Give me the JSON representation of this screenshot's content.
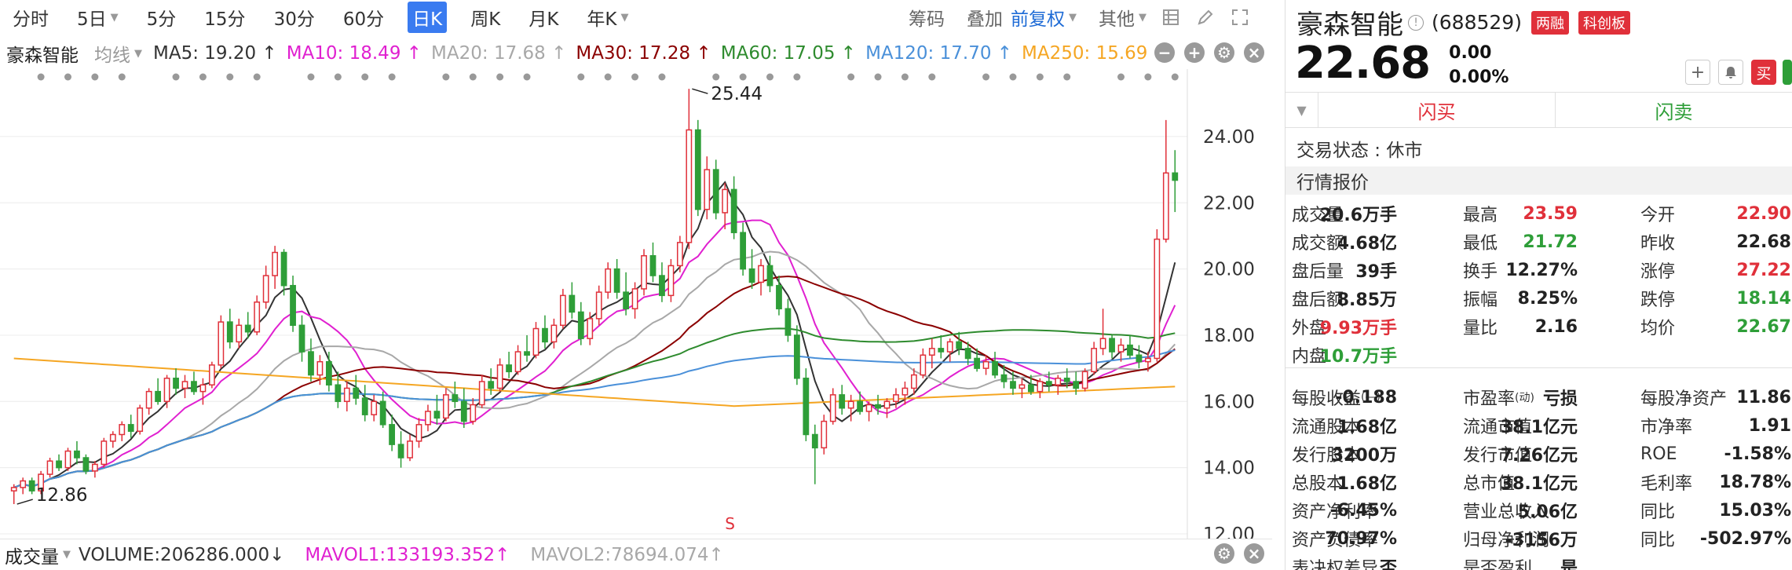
{
  "periods": [
    "分时",
    "5日",
    "5分",
    "15分",
    "30分",
    "60分",
    "日K",
    "周K",
    "月K",
    "年K"
  ],
  "active_period": "日K",
  "toolbar": {
    "chips": "筹码",
    "overlay": "叠加",
    "adjust": "前复权",
    "other": "其他"
  },
  "ma_bar": {
    "stock_name": "豪森智能",
    "mode": "均线",
    "items": [
      {
        "label": "MA5: 19.20 ↑",
        "color": "#333333"
      },
      {
        "label": "MA10: 18.49 ↑",
        "color": "#e020d0"
      },
      {
        "label": "MA20: 17.68 ↑",
        "color": "#a8a8a8"
      },
      {
        "label": "MA30: 17.28 ↑",
        "color": "#8b0000"
      },
      {
        "label": "MA60: 17.05 ↑",
        "color": "#2e8b2e"
      },
      {
        "label": "MA120: 17.70 ↑",
        "color": "#4a90d9"
      },
      {
        "label": "MA250: 15.69 ↑",
        "color": "#f5a623"
      }
    ]
  },
  "chart_annotations": {
    "high_label": "25.44",
    "low_label": "12.86",
    "signal": "S"
  },
  "volume_bar": {
    "label": "成交量",
    "items": [
      {
        "label": "VOLUME:206286.000↓",
        "color": "#333333"
      },
      {
        "label": "MAVOL1:133193.352↑",
        "color": "#e020d0"
      },
      {
        "label": "MAVOL2:78694.074↑",
        "color": "#a8a8a8"
      }
    ]
  },
  "chart_data": {
    "type": "candlestick",
    "y_ticks": [
      "24.00",
      "22.00",
      "20.00",
      "18.00",
      "16.00",
      "14.00",
      "12.00"
    ],
    "ylim": [
      12.0,
      25.8
    ],
    "grid": true,
    "high": 25.44,
    "low": 12.86,
    "candles": [
      [
        13.3,
        13.5,
        12.9,
        13.4
      ],
      [
        13.4,
        13.7,
        13.2,
        13.6
      ],
      [
        13.6,
        13.7,
        13.2,
        13.3
      ],
      [
        13.3,
        13.9,
        13.2,
        13.8
      ],
      [
        13.8,
        14.3,
        13.7,
        14.2
      ],
      [
        14.2,
        14.4,
        13.9,
        14.0
      ],
      [
        14.0,
        14.6,
        13.9,
        14.5
      ],
      [
        14.5,
        14.8,
        14.1,
        14.3
      ],
      [
        14.3,
        14.4,
        13.8,
        13.9
      ],
      [
        13.9,
        14.2,
        13.7,
        14.1
      ],
      [
        14.1,
        14.9,
        14.0,
        14.8
      ],
      [
        14.8,
        15.1,
        14.6,
        15.0
      ],
      [
        15.0,
        15.4,
        14.8,
        15.3
      ],
      [
        15.3,
        15.6,
        14.9,
        15.1
      ],
      [
        15.1,
        15.9,
        15.0,
        15.8
      ],
      [
        15.8,
        16.4,
        15.6,
        16.3
      ],
      [
        16.3,
        16.7,
        15.9,
        16.0
      ],
      [
        16.0,
        16.8,
        15.8,
        16.7
      ],
      [
        16.7,
        17.0,
        16.2,
        16.4
      ],
      [
        16.4,
        16.8,
        16.1,
        16.6
      ],
      [
        16.6,
        16.9,
        16.2,
        16.3
      ],
      [
        16.3,
        16.7,
        15.9,
        16.5
      ],
      [
        16.5,
        17.2,
        16.4,
        17.1
      ],
      [
        17.1,
        18.6,
        17.0,
        18.4
      ],
      [
        18.4,
        18.8,
        17.6,
        17.8
      ],
      [
        17.8,
        18.5,
        17.6,
        18.3
      ],
      [
        18.3,
        18.7,
        17.9,
        18.1
      ],
      [
        18.1,
        19.2,
        18.0,
        19.0
      ],
      [
        19.0,
        20.1,
        18.8,
        19.8
      ],
      [
        19.8,
        20.7,
        19.4,
        20.5
      ],
      [
        20.5,
        20.6,
        19.2,
        19.5
      ],
      [
        19.5,
        19.8,
        18.1,
        18.3
      ],
      [
        18.3,
        18.6,
        17.2,
        17.5
      ],
      [
        17.5,
        17.9,
        16.6,
        16.8
      ],
      [
        16.8,
        17.4,
        16.5,
        17.2
      ],
      [
        17.2,
        17.5,
        16.3,
        16.5
      ],
      [
        16.5,
        16.9,
        15.8,
        16.0
      ],
      [
        16.0,
        16.6,
        15.7,
        16.4
      ],
      [
        16.4,
        16.8,
        15.9,
        16.1
      ],
      [
        16.1,
        16.5,
        15.4,
        15.6
      ],
      [
        15.6,
        16.2,
        15.4,
        16.0
      ],
      [
        16.0,
        16.3,
        15.2,
        15.3
      ],
      [
        15.3,
        15.6,
        14.5,
        14.7
      ],
      [
        14.7,
        15.1,
        14.0,
        14.3
      ],
      [
        14.3,
        15.0,
        14.2,
        14.8
      ],
      [
        14.8,
        15.5,
        14.6,
        15.3
      ],
      [
        15.3,
        15.9,
        15.1,
        15.7
      ],
      [
        15.7,
        16.2,
        15.3,
        15.5
      ],
      [
        15.5,
        16.4,
        15.4,
        16.2
      ],
      [
        16.2,
        16.6,
        15.8,
        16.0
      ],
      [
        16.0,
        16.4,
        15.2,
        15.4
      ],
      [
        15.4,
        16.1,
        15.3,
        15.9
      ],
      [
        15.9,
        16.8,
        15.8,
        16.6
      ],
      [
        16.6,
        17.0,
        16.2,
        16.4
      ],
      [
        16.4,
        17.3,
        16.3,
        17.1
      ],
      [
        17.1,
        17.5,
        16.7,
        16.9
      ],
      [
        16.9,
        17.7,
        16.8,
        17.5
      ],
      [
        17.5,
        18.0,
        17.2,
        17.4
      ],
      [
        17.4,
        18.4,
        17.3,
        18.2
      ],
      [
        18.2,
        18.6,
        17.6,
        17.8
      ],
      [
        17.8,
        18.5,
        17.6,
        18.3
      ],
      [
        18.3,
        19.4,
        18.2,
        19.2
      ],
      [
        19.2,
        19.6,
        18.5,
        18.7
      ],
      [
        18.7,
        19.0,
        17.7,
        17.9
      ],
      [
        17.9,
        18.7,
        17.7,
        18.5
      ],
      [
        18.5,
        19.5,
        18.3,
        19.3
      ],
      [
        19.3,
        20.2,
        19.1,
        20.0
      ],
      [
        20.0,
        20.3,
        19.1,
        19.3
      ],
      [
        19.3,
        19.9,
        18.6,
        18.8
      ],
      [
        18.8,
        19.6,
        18.5,
        19.4
      ],
      [
        19.4,
        20.6,
        19.2,
        20.4
      ],
      [
        20.4,
        20.8,
        19.6,
        19.8
      ],
      [
        19.8,
        20.2,
        19.0,
        19.2
      ],
      [
        19.2,
        20.3,
        19.0,
        20.1
      ],
      [
        20.1,
        21.0,
        19.9,
        20.8
      ],
      [
        20.8,
        25.44,
        20.6,
        24.2
      ],
      [
        24.2,
        24.5,
        21.6,
        21.8
      ],
      [
        21.8,
        23.4,
        21.5,
        23.0
      ],
      [
        23.0,
        23.3,
        21.5,
        21.7
      ],
      [
        21.7,
        22.6,
        21.2,
        22.4
      ],
      [
        22.4,
        22.8,
        20.9,
        21.1
      ],
      [
        21.1,
        21.4,
        19.8,
        20.0
      ],
      [
        20.0,
        20.6,
        19.4,
        19.6
      ],
      [
        19.6,
        20.3,
        19.2,
        20.1
      ],
      [
        20.1,
        20.4,
        19.3,
        19.5
      ],
      [
        19.5,
        19.8,
        18.6,
        18.8
      ],
      [
        18.8,
        19.1,
        17.8,
        18.0
      ],
      [
        18.0,
        18.3,
        16.5,
        16.7
      ],
      [
        16.7,
        17.0,
        14.8,
        15.0
      ],
      [
        15.0,
        15.3,
        13.5,
        14.6
      ],
      [
        14.6,
        15.6,
        14.4,
        15.4
      ],
      [
        15.4,
        16.4,
        15.3,
        16.2
      ],
      [
        16.2,
        16.5,
        15.6,
        15.8
      ],
      [
        15.8,
        16.2,
        15.4,
        16.0
      ],
      [
        16.0,
        16.3,
        15.6,
        15.7
      ],
      [
        15.7,
        16.0,
        15.4,
        15.9
      ],
      [
        15.9,
        16.2,
        15.6,
        15.8
      ],
      [
        15.8,
        16.1,
        15.5,
        16.0
      ],
      [
        16.0,
        16.4,
        15.8,
        16.2
      ],
      [
        16.2,
        16.6,
        15.9,
        16.4
      ],
      [
        16.4,
        17.0,
        16.2,
        16.8
      ],
      [
        16.8,
        17.6,
        16.7,
        17.4
      ],
      [
        17.4,
        17.9,
        17.0,
        17.6
      ],
      [
        17.6,
        18.0,
        17.3,
        17.5
      ],
      [
        17.5,
        17.9,
        17.2,
        17.8
      ],
      [
        17.8,
        18.1,
        17.4,
        17.6
      ],
      [
        17.6,
        17.8,
        17.1,
        17.3
      ],
      [
        17.3,
        17.6,
        16.9,
        17.0
      ],
      [
        17.0,
        17.4,
        16.8,
        17.2
      ],
      [
        17.2,
        17.5,
        16.7,
        16.8
      ],
      [
        16.8,
        17.1,
        16.4,
        16.6
      ],
      [
        16.6,
        16.9,
        16.2,
        16.4
      ],
      [
        16.4,
        16.7,
        16.1,
        16.5
      ],
      [
        16.5,
        16.8,
        16.2,
        16.3
      ],
      [
        16.3,
        16.7,
        16.1,
        16.6
      ],
      [
        16.6,
        16.9,
        16.3,
        16.5
      ],
      [
        16.5,
        16.8,
        16.2,
        16.7
      ],
      [
        16.7,
        17.0,
        16.4,
        16.6
      ],
      [
        16.6,
        16.9,
        16.2,
        16.4
      ],
      [
        16.4,
        17.0,
        16.3,
        16.9
      ],
      [
        16.9,
        17.8,
        16.8,
        17.6
      ],
      [
        17.6,
        18.8,
        17.4,
        17.9
      ],
      [
        17.9,
        18.0,
        17.3,
        17.5
      ],
      [
        17.5,
        17.9,
        17.2,
        17.7
      ],
      [
        17.7,
        18.0,
        17.3,
        17.4
      ],
      [
        17.4,
        17.7,
        17.0,
        17.2
      ],
      [
        17.2,
        17.5,
        16.9,
        17.3
      ],
      [
        17.3,
        21.2,
        17.2,
        20.9
      ],
      [
        20.9,
        24.5,
        20.8,
        22.9
      ],
      [
        22.9,
        23.59,
        21.72,
        22.68
      ]
    ]
  },
  "quote": {
    "name": "豪森智能",
    "code": "(688529)",
    "tags": [
      "两融",
      "科创板"
    ],
    "price": "22.68",
    "change": "0.00",
    "change_pct": "0.00%",
    "buy_btn": "买",
    "flash_buy": "闪买",
    "flash_sell": "闪卖",
    "status": "交易状态 : 休市",
    "section": "行情报价",
    "rows": [
      [
        [
          "成交量",
          "20.6万手",
          ""
        ],
        [
          "最高",
          "23.59",
          "red"
        ],
        [
          "今开",
          "22.90",
          "red"
        ]
      ],
      [
        [
          "成交额",
          "4.68亿",
          ""
        ],
        [
          "最低",
          "21.72",
          "green"
        ],
        [
          "昨收",
          "22.68",
          ""
        ]
      ],
      [
        [
          "盘后量",
          "39手",
          ""
        ],
        [
          "换手",
          "12.27%",
          ""
        ],
        [
          "涨停",
          "27.22",
          "red"
        ]
      ],
      [
        [
          "盘后额",
          "8.85万",
          ""
        ],
        [
          "振幅",
          "8.25%",
          ""
        ],
        [
          "跌停",
          "18.14",
          "green"
        ]
      ],
      [
        [
          "外盘",
          "9.93万手",
          "red"
        ],
        [
          "量比",
          "2.16",
          ""
        ],
        [
          "均价",
          "22.67",
          "green"
        ]
      ],
      [
        [
          "内盘",
          "10.7万手",
          "green"
        ],
        [
          "",
          "",
          " "
        ],
        [
          "",
          "",
          " "
        ]
      ],
      [
        [
          "每股收益",
          "-0.188",
          ""
        ],
        [
          "市盈率",
          "亏损",
          ""
        ],
        [
          "每股净资产",
          "11.86",
          ""
        ]
      ],
      [
        [
          "流通股本",
          "1.68亿",
          ""
        ],
        [
          "流通市值",
          "38.1亿元",
          ""
        ],
        [
          "市净率",
          "1.91",
          ""
        ]
      ],
      [
        [
          "发行股本",
          "3200万",
          ""
        ],
        [
          "发行市值",
          "7.26亿元",
          ""
        ],
        [
          "ROE",
          "-1.58%",
          ""
        ]
      ],
      [
        [
          "总股本",
          "1.68亿",
          ""
        ],
        [
          "总市值",
          "38.1亿元",
          ""
        ],
        [
          "毛利率",
          "18.78%",
          ""
        ]
      ],
      [
        [
          "资产净利率",
          "-6.45%",
          ""
        ],
        [
          "营业总收入",
          "5.06亿",
          ""
        ],
        [
          "同比",
          "15.03%",
          ""
        ]
      ],
      [
        [
          "资产负债率",
          "70.97%",
          ""
        ],
        [
          "归母净利润",
          "-3156万",
          ""
        ],
        [
          "同比",
          "-502.97%",
          ""
        ]
      ],
      [
        [
          "表决权差异",
          "否",
          ""
        ],
        [
          "是否盈利",
          "是",
          ""
        ],
        [
          "",
          "",
          " "
        ]
      ]
    ],
    "suffix_eps": "(—)",
    "suffix_pe": "(动)"
  }
}
